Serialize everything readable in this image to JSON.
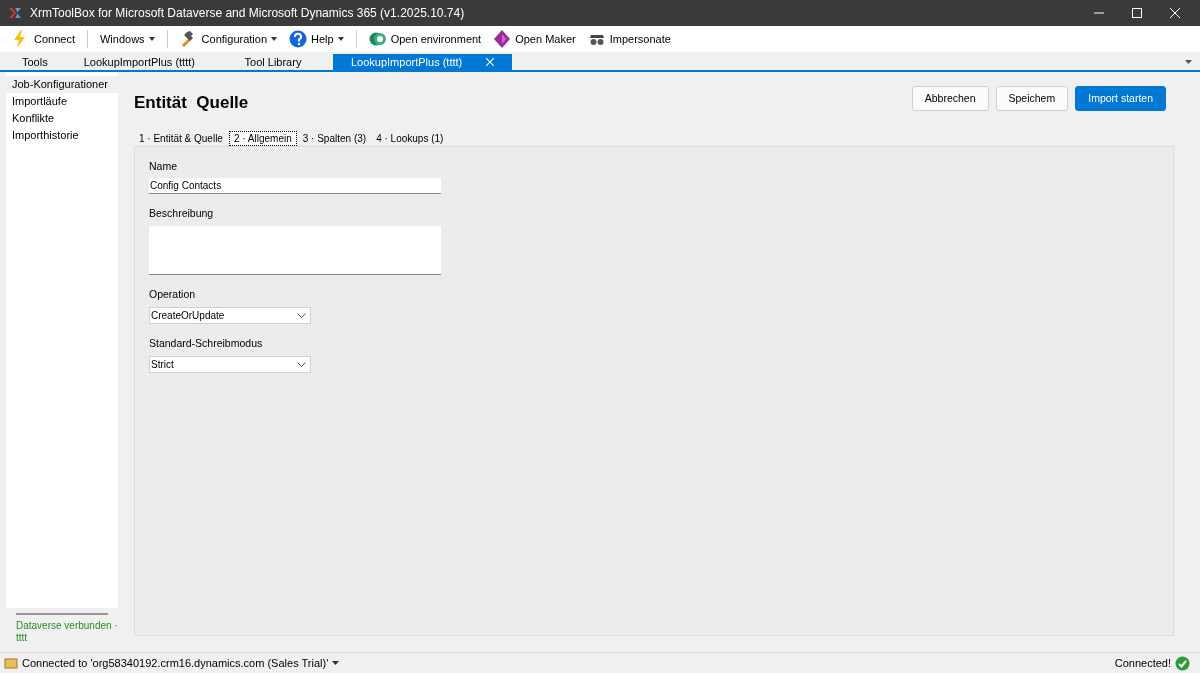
{
  "window": {
    "title": "XrmToolBox for Microsoft Dataverse and Microsoft Dynamics 365 (v1.2025.10.74)"
  },
  "toolbar": [
    {
      "kind": "connect",
      "label": "Connect",
      "dropdown": false
    },
    {
      "kind": "plain",
      "label": "Windows",
      "dropdown": true
    },
    {
      "kind": "config",
      "label": "Configuration",
      "dropdown": true
    },
    {
      "kind": "help",
      "label": "Help",
      "dropdown": true
    },
    {
      "kind": "env",
      "label": "Open environment",
      "dropdown": false
    },
    {
      "kind": "maker",
      "label": "Open Maker",
      "dropdown": false
    },
    {
      "kind": "spy",
      "label": "Impersonate",
      "dropdown": false
    }
  ],
  "doc_tabs": [
    {
      "label": "Tools",
      "selected": false,
      "closable": false
    },
    {
      "label": "LookupImportPlus (tttt)",
      "selected": false,
      "closable": false
    },
    {
      "label": "Tool Library",
      "selected": false,
      "closable": false
    },
    {
      "label": "LookupImportPlus (tttt)",
      "selected": true,
      "closable": true
    }
  ],
  "sidebar": {
    "items": [
      {
        "label": "Job-Konfigurationer",
        "selected": true
      },
      {
        "label": "Importläufe",
        "selected": false
      },
      {
        "label": "Konflikte",
        "selected": false
      },
      {
        "label": "Importhistorie",
        "selected": false
      }
    ],
    "status": "Dataverse verbunden · tttt"
  },
  "heading": "Entität  Quelle",
  "actions": [
    {
      "label": "Abbrechen",
      "primary": false
    },
    {
      "label": "Speichem",
      "primary": false
    },
    {
      "label": "Import starten",
      "primary": true
    }
  ],
  "steps": [
    {
      "label": "1 · Entität & Quelle",
      "selected": false
    },
    {
      "label": "2 · Allgemein",
      "selected": true
    },
    {
      "label": "3 · Spalten (3)",
      "selected": false
    },
    {
      "label": "4 · Lookups (1)",
      "selected": false
    }
  ],
  "form": [
    {
      "kind": "text",
      "label": "Name",
      "value": "Config Contacts"
    },
    {
      "kind": "textarea",
      "label": "Beschreibung"
    },
    {
      "kind": "select",
      "label": "Operation",
      "value": "CreateOrUpdate"
    },
    {
      "kind": "select",
      "label": "Standard-Schreibmodus",
      "value": "Strict"
    }
  ],
  "status_bar": {
    "connection": "Connected to 'org58340192.crm16.dynamics.com (Sales Trial)'",
    "state": "Connected!"
  }
}
